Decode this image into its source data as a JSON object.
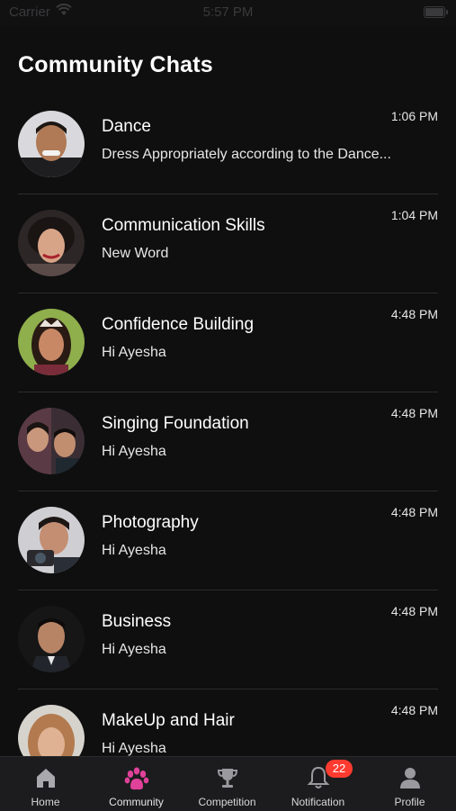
{
  "status_bar": {
    "carrier": "Carrier",
    "time": "5:57 PM"
  },
  "page_title": "Community Chats",
  "chats": [
    {
      "name": "Dance",
      "preview": "Dress Appropriately according to the Dance...",
      "time": "1:06 PM"
    },
    {
      "name": "Communication Skills",
      "preview": "New Word",
      "time": "1:04 PM"
    },
    {
      "name": "Confidence Building",
      "preview": "Hi Ayesha",
      "time": "4:48 PM"
    },
    {
      "name": "Singing Foundation",
      "preview": "Hi Ayesha",
      "time": "4:48 PM"
    },
    {
      "name": "Photography",
      "preview": "Hi Ayesha",
      "time": "4:48 PM"
    },
    {
      "name": "Business",
      "preview": "Hi Ayesha",
      "time": "4:48 PM"
    },
    {
      "name": "MakeUp and Hair",
      "preview": "Hi Ayesha",
      "time": "4:48 PM"
    }
  ],
  "tab_bar": {
    "items": [
      {
        "label": "Home",
        "icon": "home-icon"
      },
      {
        "label": "Community",
        "icon": "paw-icon",
        "active": true
      },
      {
        "label": "Competition",
        "icon": "trophy-icon"
      },
      {
        "label": "Notification",
        "icon": "bell-icon",
        "badge": "22"
      },
      {
        "label": "Profile",
        "icon": "person-icon"
      }
    ]
  },
  "colors": {
    "background": "#0f0f10",
    "tab_bar": "#1c1c1e",
    "accent": "#e0429a",
    "badge": "#ff3b30",
    "divider": "#2c2c2e"
  }
}
